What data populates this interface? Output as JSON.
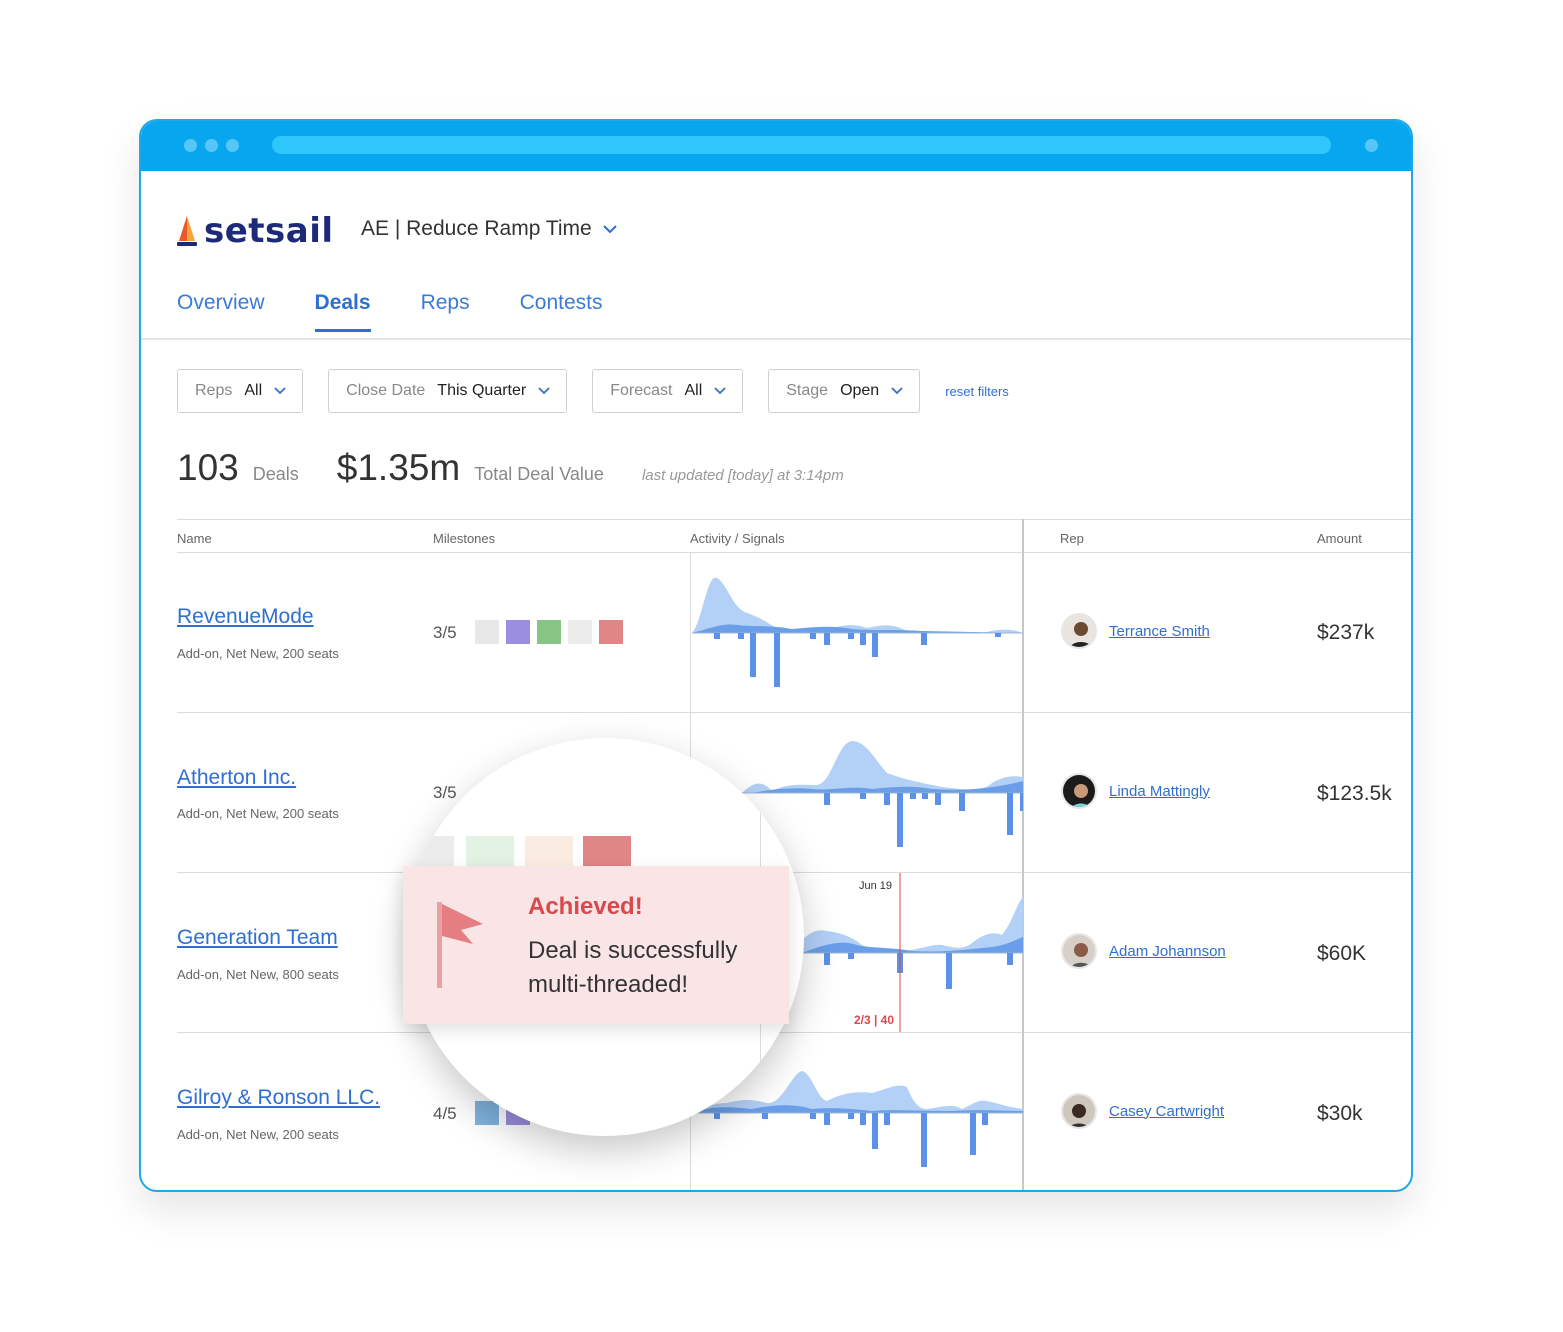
{
  "app": {
    "logo_text": "setsail",
    "project": "AE | Reduce Ramp Time"
  },
  "tabs": [
    "Overview",
    "Deals",
    "Reps",
    "Contests"
  ],
  "filters": [
    {
      "label": "Reps",
      "value": "All"
    },
    {
      "label": "Close Date",
      "value": "This Quarter"
    },
    {
      "label": "Forecast",
      "value": "All"
    },
    {
      "label": "Stage",
      "value": "Open"
    }
  ],
  "reset_label": "reset filters",
  "stats": {
    "deals_count": "103",
    "deals_label": "Deals",
    "value": "$1.35m",
    "value_label": "Total Deal Value",
    "updated": "last updated [today] at 3:14pm"
  },
  "columns": [
    "Name",
    "Milestones",
    "Activity / Signals",
    "Rep",
    "Amount"
  ],
  "deals": [
    {
      "name": "RevenueMode",
      "sub": "Add-on, Net New, 200 seats",
      "milestones": "3/5",
      "rep": "Terrance Smith",
      "amount": "$237k",
      "ms_colors": [
        "#e7e7e7",
        "#9b8ee0",
        "#86c584",
        "#ececec",
        "#e08686"
      ]
    },
    {
      "name": "Atherton Inc.",
      "sub": "Add-on, Net New, 200 seats",
      "milestones": "3/5",
      "rep": "Linda Mattingly",
      "amount": "$123.5k",
      "ms_colors": [
        "#7fb3dd",
        "#9b8ee0",
        "#86c584",
        "#f6d7c4",
        "#e08686"
      ]
    },
    {
      "name": "Generation Team",
      "sub": "Add-on, Net New, 800 seats",
      "milestones": "",
      "rep": "Adam Johannson",
      "amount": "$60K",
      "ms_colors": []
    },
    {
      "name": "Gilroy & Ronson LLC.",
      "sub": "Add-on, Net New, 200 seats",
      "milestones": "4/5",
      "rep": "Casey Cartwright",
      "amount": "$30k",
      "ms_colors": [
        "#7fb3dd",
        "#9b8ee0"
      ]
    }
  ],
  "marker": {
    "date": "Jun 19",
    "value": "2/3 | 40"
  },
  "callout": {
    "title": "Achieved!",
    "text": "Deal is successfully multi-threaded!"
  },
  "colors": {
    "brand": "#1d2a7a",
    "accent": "#2f6fd0",
    "titlebar": "#08a6ef",
    "achieved": "#d9494b"
  }
}
